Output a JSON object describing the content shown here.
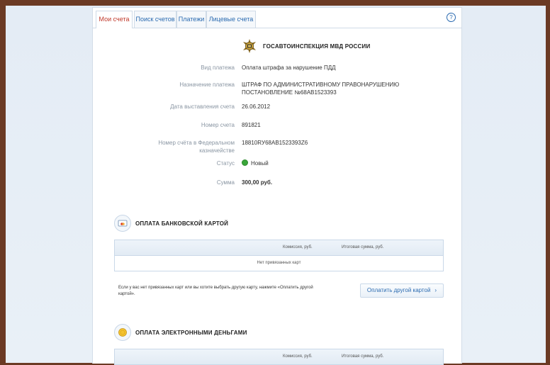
{
  "tabs": [
    {
      "label": "Мои счета",
      "active": true
    },
    {
      "label": "Поиск счетов",
      "active": false
    },
    {
      "label": "Платежи",
      "active": false
    },
    {
      "label": "Лицевые счета",
      "active": false
    }
  ],
  "help": "?",
  "org": {
    "name": "ГОСАВТОИНСПЕКЦИЯ МВД РОССИИ",
    "emblem_icon": "police-emblem-icon"
  },
  "invoice": {
    "payment_type_label": "Вид платежа",
    "payment_type": "Оплата штрафа за нарушение ПДД",
    "purpose_label": "Назначение платежа",
    "purpose_line1": "ШТРАФ ПО АДМИНИСТРАТИВНОМУ ПРАВОНАРУШЕНИЮ",
    "purpose_line2": "ПОСТАНОВЛЕНИЕ №68АВ1523393",
    "date_label": "Дата выставления счета",
    "date": "26.06.2012",
    "number_label": "Номер счета",
    "number": "891821",
    "treasury_label_line1": "Номер счёта в Федеральном",
    "treasury_label_line2": "казначействе",
    "treasury_number": "18810RУ68АВ1523393Z6",
    "status_label": "Статус",
    "status": "Новый",
    "status_color": "#3aa63a",
    "amount_label": "Сумма",
    "amount": "300,00 руб."
  },
  "card_section": {
    "title": "ОПЛАТА БАНКОВСКОЙ КАРТОЙ",
    "col_fee": "Комиссия, руб.",
    "col_total": "Итоговая сумма, руб.",
    "empty": "Нет привязанных карт",
    "note_line1": "Если у вас нет привязанных карт или вы хотите выбрать другую карту, нажмите «Оплатить другой",
    "note_line2": "картой».",
    "button": "Оплатить другой картой",
    "button_chevron": "›"
  },
  "emoney_section": {
    "title": "ОПЛАТА ЭЛЕКТРОННЫМИ ДЕНЬГАМИ",
    "col_fee": "Комиссия, руб.",
    "col_total": "Итоговая сумма, руб."
  }
}
